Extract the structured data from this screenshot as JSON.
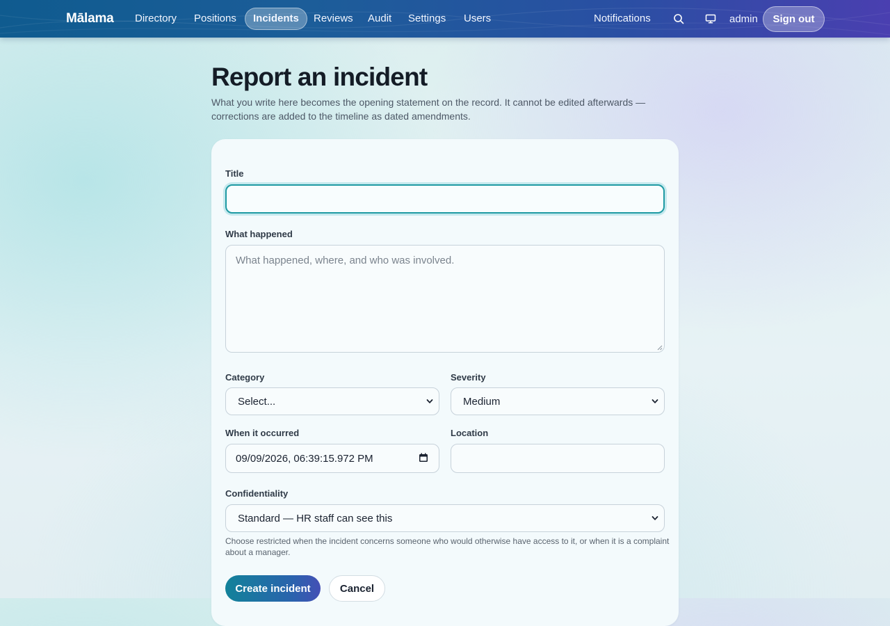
{
  "nav": {
    "brand": "Mālama",
    "items": [
      {
        "label": "Directory",
        "active": false
      },
      {
        "label": "Positions",
        "active": false
      },
      {
        "label": "Incidents",
        "active": true
      },
      {
        "label": "Reviews",
        "active": false
      },
      {
        "label": "Audit",
        "active": false
      },
      {
        "label": "Settings",
        "active": false
      },
      {
        "label": "Users",
        "active": false
      }
    ],
    "notifications_label": "Notifications",
    "search_icon": "search-icon",
    "display_icon": "monitor-icon",
    "user": "admin",
    "sign_out_label": "Sign out"
  },
  "page": {
    "title": "Report an incident",
    "intro": "What you write here becomes the opening statement on the record. It cannot be edited afterwards — corrections are added to the timeline as dated amendments."
  },
  "form": {
    "title": {
      "label": "Title",
      "value": ""
    },
    "what_happened": {
      "label": "What happened",
      "value": "",
      "placeholder": "What happened, where, and who was involved."
    },
    "category": {
      "label": "Category",
      "value": "Select..."
    },
    "severity": {
      "label": "Severity",
      "value": "Medium"
    },
    "occurred": {
      "label": "When it occurred",
      "value": "09/09/2026, 06:39:15.972 PM"
    },
    "location": {
      "label": "Location",
      "value": ""
    },
    "confidentiality": {
      "label": "Confidentiality",
      "value": "Standard — HR staff can see this",
      "help": "Choose restricted when the incident concerns someone who would otherwise have access to it, or when it is a complaint about a manager."
    },
    "submit_label": "Create incident",
    "cancel_label": "Cancel"
  },
  "colors": {
    "nav_gradient_start": "#0f5b8f",
    "nav_gradient_end": "#4a3fb0",
    "focus_ring": "#1f9aa3",
    "primary_button": "#2a63ad"
  }
}
